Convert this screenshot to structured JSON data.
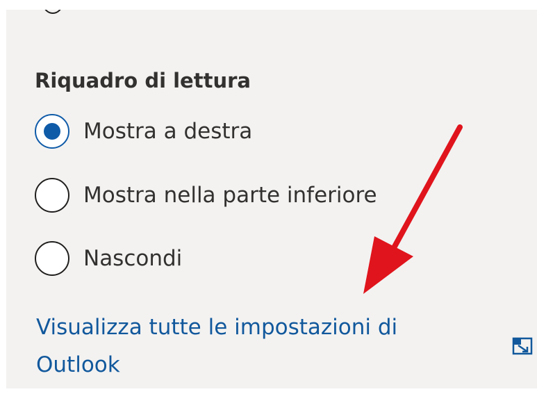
{
  "reading_pane": {
    "title": "Riquadro di lettura",
    "options": [
      {
        "label": "Mostra a destra",
        "checked": true
      },
      {
        "label": "Mostra nella parte inferiore",
        "checked": false
      },
      {
        "label": "Nascondi",
        "checked": false
      }
    ]
  },
  "footer": {
    "link_text": "Visualizza tutte le impostazioni di Outlook",
    "popout_icon": "popout-icon"
  },
  "colors": {
    "accent": "#0f5ba8",
    "link": "#11589c",
    "panel_background": "#f3f2f1",
    "annotation_arrow": "#e0141c"
  }
}
